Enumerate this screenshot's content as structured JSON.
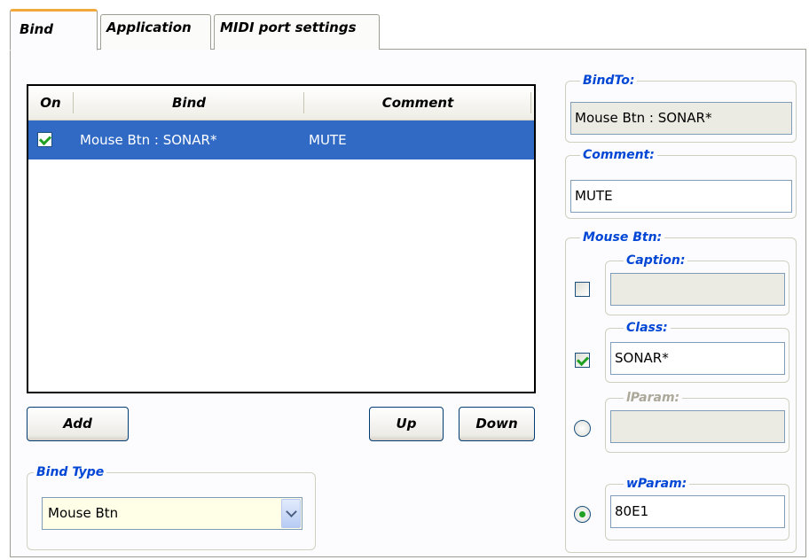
{
  "tabs": [
    {
      "label": "Bind",
      "active": true
    },
    {
      "label": "Application",
      "active": false
    },
    {
      "label": "MIDI port settings",
      "active": false
    }
  ],
  "list": {
    "columns": [
      "On",
      "Bind",
      "Comment"
    ],
    "rows": [
      {
        "on": true,
        "bind": "Mouse Btn : SONAR*",
        "comment": "MUTE",
        "selected": true
      }
    ]
  },
  "buttons": {
    "add": "Add",
    "up": "Up",
    "down": "Down"
  },
  "bind_type": {
    "label": "Bind Type",
    "value": "Mouse Btn"
  },
  "bind_to": {
    "label": "BindTo:",
    "value": "Mouse Btn : SONAR*"
  },
  "comment": {
    "label": "Comment:",
    "value": "MUTE"
  },
  "mouse_btn": {
    "label": "Mouse Btn:",
    "caption": {
      "label": "Caption:",
      "value": "",
      "checked": false
    },
    "class": {
      "label": "Class:",
      "value": "SONAR*",
      "checked": true
    },
    "lparam": {
      "label": "lParam:",
      "value": "",
      "selected": false,
      "disabled": true
    },
    "wparam": {
      "label": "wParam:",
      "value": "80E1",
      "selected": true
    }
  },
  "colors": {
    "selection": "#316ac5",
    "group_label": "#0046d5",
    "tab_accent": "#f2a93c",
    "check": "#21a121"
  }
}
